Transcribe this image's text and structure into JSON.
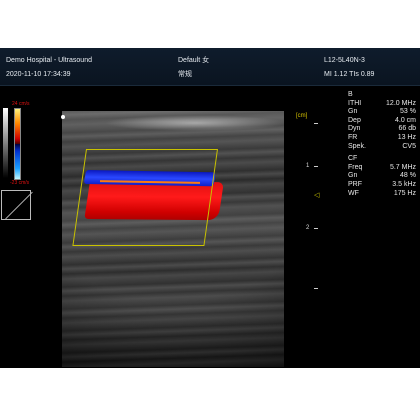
{
  "header": {
    "institution": "Demo Hospital - Ultrasound",
    "datetime": "2020-11-10 17:34:39",
    "preset": "Default 女",
    "exam": "常规",
    "probe": "L12-5L40N-3",
    "indices": "MI 1.12  TIs 0.89"
  },
  "color_scale": {
    "max": "24 cm/s",
    "min": "-23 cm/s"
  },
  "ruler": {
    "unit": "[cm]",
    "marks": [
      "1",
      "2"
    ]
  },
  "params": {
    "b_mode": {
      "title": "B",
      "rows": [
        {
          "k": "ITHI",
          "v": "12.0 MHz"
        },
        {
          "k": "Gn",
          "v": "53 %"
        },
        {
          "k": "Dep",
          "v": "4.0 cm"
        },
        {
          "k": "Dyn",
          "v": "66 db"
        },
        {
          "k": "FR",
          "v": "13 Hz"
        },
        {
          "k": "Spek.",
          "v": "CV5"
        }
      ]
    },
    "cf_mode": {
      "title": "CF",
      "rows": [
        {
          "k": "Freq",
          "v": "5.7 MHz"
        },
        {
          "k": "Gn",
          "v": "48 %"
        },
        {
          "k": "PRF",
          "v": "3.5 kHz"
        },
        {
          "k": "WF",
          "v": "175 Hz"
        }
      ]
    }
  },
  "colors": {
    "flow_toward": "#ff1a1a",
    "flow_away": "#1f3cff",
    "roi_box": "#c9c200"
  }
}
